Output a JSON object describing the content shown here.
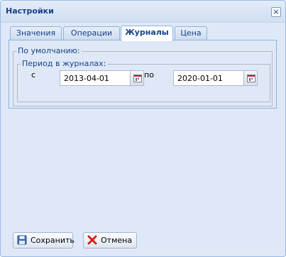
{
  "window": {
    "title": "Настройки",
    "close_icon": "close-icon"
  },
  "tabs": [
    {
      "label": "Значения"
    },
    {
      "label": "Операции"
    },
    {
      "label": "Журналы"
    },
    {
      "label": "Цена"
    }
  ],
  "active_tab": "Журналы",
  "journals": {
    "default_legend": "По умолчанию:",
    "period_legend": "Период в журналах:",
    "from_label": "с",
    "from_value": "2013-04-01",
    "to_label": "по",
    "to_value": "2020-01-01"
  },
  "footer": {
    "save_label": "Сохранить",
    "cancel_label": "Отмена"
  },
  "icons": {
    "save": "floppy-disk-icon",
    "cancel": "red-x-icon",
    "calendar": "calendar-icon"
  },
  "colors": {
    "title": "#15428b",
    "background": "#dfe8f6",
    "border": "#99bbe8"
  }
}
